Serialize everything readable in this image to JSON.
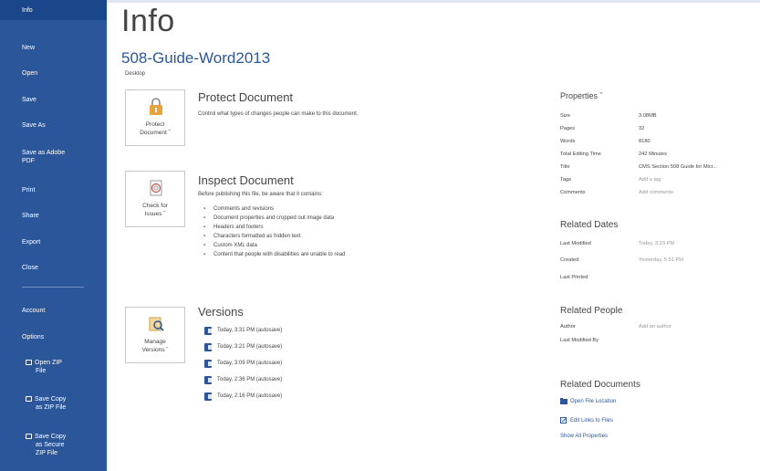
{
  "sidebar": {
    "items": [
      {
        "label": "Info"
      },
      {
        "label": "New"
      },
      {
        "label": "Open"
      },
      {
        "label": "Save"
      },
      {
        "label": "Save As"
      },
      {
        "label": "Save as Adobe",
        "label2": "PDF"
      },
      {
        "label": "Print"
      },
      {
        "label": "Share"
      },
      {
        "label": "Export"
      },
      {
        "label": "Close"
      },
      {
        "label": "Account"
      },
      {
        "label": "Options"
      },
      {
        "label": "Open ZIP",
        "label2": "File"
      },
      {
        "label": "Save Copy",
        "label2": "as ZIP File"
      },
      {
        "label": "Save Copy",
        "label2": "as Secure",
        "label3": "ZIP File"
      }
    ]
  },
  "main": {
    "title": "Info",
    "doc_name": "508-Guide-Word2013",
    "doc_location": "Desktop"
  },
  "protect": {
    "tile_line1": "Protect",
    "tile_line2": "Document ˇ",
    "title": "Protect Document",
    "desc": "Control what types of changes people can make to this document."
  },
  "inspect": {
    "tile_line1": "Check for",
    "tile_line2": "Issues ˇ",
    "title": "Inspect Document",
    "desc": "Before publishing this file, be aware that it contains:",
    "bullets": [
      "Comments and revisions",
      "Document properties and cropped out image data",
      "Headers and footers",
      "Characters formatted as hidden text",
      "Custom XML data",
      "Content that people with disabilities are unable to read"
    ]
  },
  "versions": {
    "tile_line1": "Manage",
    "tile_line2": "Versions ˇ",
    "title": "Versions",
    "items": [
      "Today, 3:31 PM (autosave)",
      "Today, 3:21 PM (autosave)",
      "Today, 3:09 PM (autosave)",
      "Today, 2:36 PM (autosave)",
      "Today, 2:16 PM (autosave)"
    ]
  },
  "properties": {
    "heading": "Properties ˇ",
    "rows": [
      {
        "key": "Size",
        "value": "3.08MB"
      },
      {
        "key": "Pages",
        "value": "32"
      },
      {
        "key": "Words",
        "value": "8180"
      },
      {
        "key": "Total Editing Time",
        "value": "242 Minutes"
      },
      {
        "key": "Title",
        "value": "CMS Section 508 Guide for Micr..."
      },
      {
        "key": "Tags",
        "value": "Add a tag"
      },
      {
        "key": "Comments",
        "value": "Add comments"
      }
    ]
  },
  "related_dates": {
    "title": "Related Dates",
    "rows": [
      {
        "key": "Last Modified",
        "value": "Today, 3:23 PM"
      },
      {
        "key": "Created",
        "value": "Yesterday, 5:51 PM"
      },
      {
        "key": "Last Printed",
        "value": ""
      }
    ]
  },
  "related_people": {
    "title": "Related People",
    "rows": [
      {
        "key": "Author",
        "value": "Add an author"
      },
      {
        "key": "Last Modified By",
        "value": ""
      }
    ]
  },
  "related_documents": {
    "title": "Related Documents",
    "open_location": "Open File Location",
    "edit_links": "Edit Links to Files",
    "show_all": "Show All Properties"
  },
  "colors": {
    "sidebar": "#2b579a",
    "sidebar_active": "#19478a",
    "accent": "#2b579a",
    "icon_orange": "#e8a33c"
  }
}
